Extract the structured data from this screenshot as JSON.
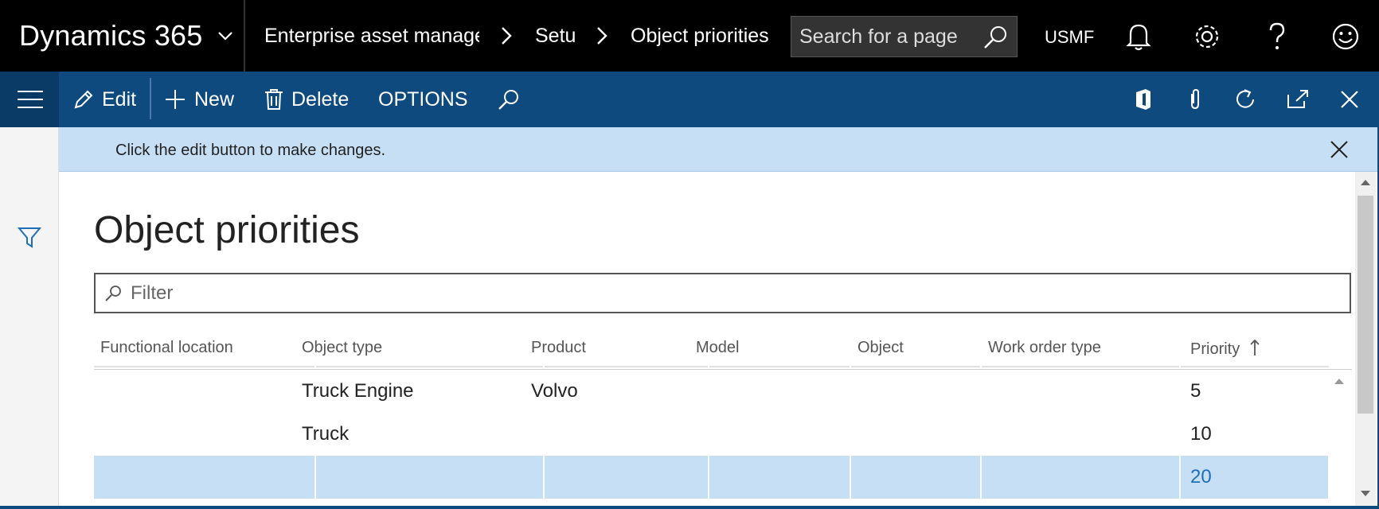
{
  "topbar": {
    "brand": "Dynamics 365",
    "breadcrumbs": [
      "Enterprise asset management",
      "Setup",
      "Object priorities"
    ],
    "search_placeholder": "Search for a page",
    "company": "USMF"
  },
  "actionbar": {
    "edit": "Edit",
    "new": "New",
    "delete": "Delete",
    "options": "OPTIONS"
  },
  "message": {
    "text": "Click the edit button to make changes."
  },
  "page": {
    "title": "Object priorities",
    "filter_placeholder": "Filter"
  },
  "grid": {
    "columns": [
      "Functional location",
      "Object type",
      "Product",
      "Model",
      "Object",
      "Work order type",
      "Priority"
    ],
    "sort_column": "Priority",
    "sort_direction": "ascending",
    "rows": [
      {
        "functional_location": "",
        "object_type": "Truck Engine",
        "product": "Volvo",
        "model": "",
        "object": "",
        "work_order_type": "",
        "priority": "5"
      },
      {
        "functional_location": "",
        "object_type": "Truck",
        "product": "",
        "model": "",
        "object": "",
        "work_order_type": "",
        "priority": "10"
      },
      {
        "functional_location": "",
        "object_type": "",
        "product": "",
        "model": "",
        "object": "",
        "work_order_type": "",
        "priority": "20",
        "selected": true
      }
    ]
  },
  "colors": {
    "topbar_bg": "#000000",
    "actionbar_bg": "#0e4a7e",
    "message_bg": "#c7dff5",
    "selected_row_bg": "#c7dff5",
    "link_blue": "#1f6fb8"
  }
}
